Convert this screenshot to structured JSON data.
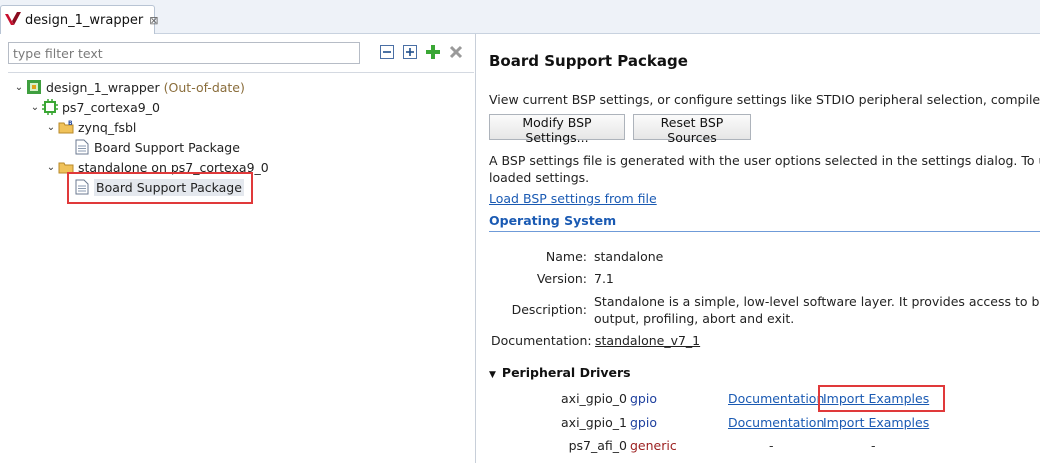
{
  "tab": {
    "title": "design_1_wrapper",
    "close_glyph": "⊠"
  },
  "filter": {
    "placeholder": "type filter text",
    "value": ""
  },
  "toolbar_icons": [
    "collapse-all-icon",
    "expand-all-icon",
    "add-icon",
    "remove-icon"
  ],
  "tree": {
    "root_label": "design_1_wrapper",
    "root_status": "(Out-of-date)",
    "processor_label": "ps7_cortexa9_0",
    "fsbl_label": "zynq_fsbl",
    "fsbl_child_label": "Board Support Package",
    "standalone_label": "standalone on ps7_cortexa9_0",
    "standalone_child_label": "Board Support Package"
  },
  "bsp": {
    "title": "Board Support Package",
    "description": "View current BSP settings, or configure settings like STDIO peripheral selection, compiler flags,",
    "modify_button": "Modify BSP Settings...",
    "reset_button": "Reset BSP Sources",
    "info_line1": "A BSP settings file is generated with the user options selected in the settings dialog. To use exi",
    "info_line2": "loaded settings.",
    "load_link": "Load BSP settings from file"
  },
  "os": {
    "heading": "Operating System",
    "name_label": "Name:",
    "name_value": "standalone",
    "version_label": "Version:",
    "version_value": "7.1",
    "description_label": "Description:",
    "description_line1": "Standalone is a simple, low-level software layer. It provides access to basic p",
    "description_line2": "output, profiling, abort and exit.",
    "documentation_label": "Documentation:",
    "documentation_link": "standalone_v7_1"
  },
  "drivers": {
    "heading": "Peripheral Drivers",
    "rows": [
      {
        "name": "axi_gpio_0",
        "type": "gpio",
        "doc": "Documentation",
        "examples": "Import Examples"
      },
      {
        "name": "axi_gpio_1",
        "type": "gpio",
        "doc": "Documentation",
        "examples": "Import Examples"
      },
      {
        "name": "ps7_afi_0",
        "type": "generic",
        "doc": "-",
        "examples": "-"
      }
    ]
  },
  "colors": {
    "link": "#1a5ab3",
    "highlight": "#e0393a",
    "gpio": "#1d3f9e",
    "generic": "#9b1d1d"
  }
}
